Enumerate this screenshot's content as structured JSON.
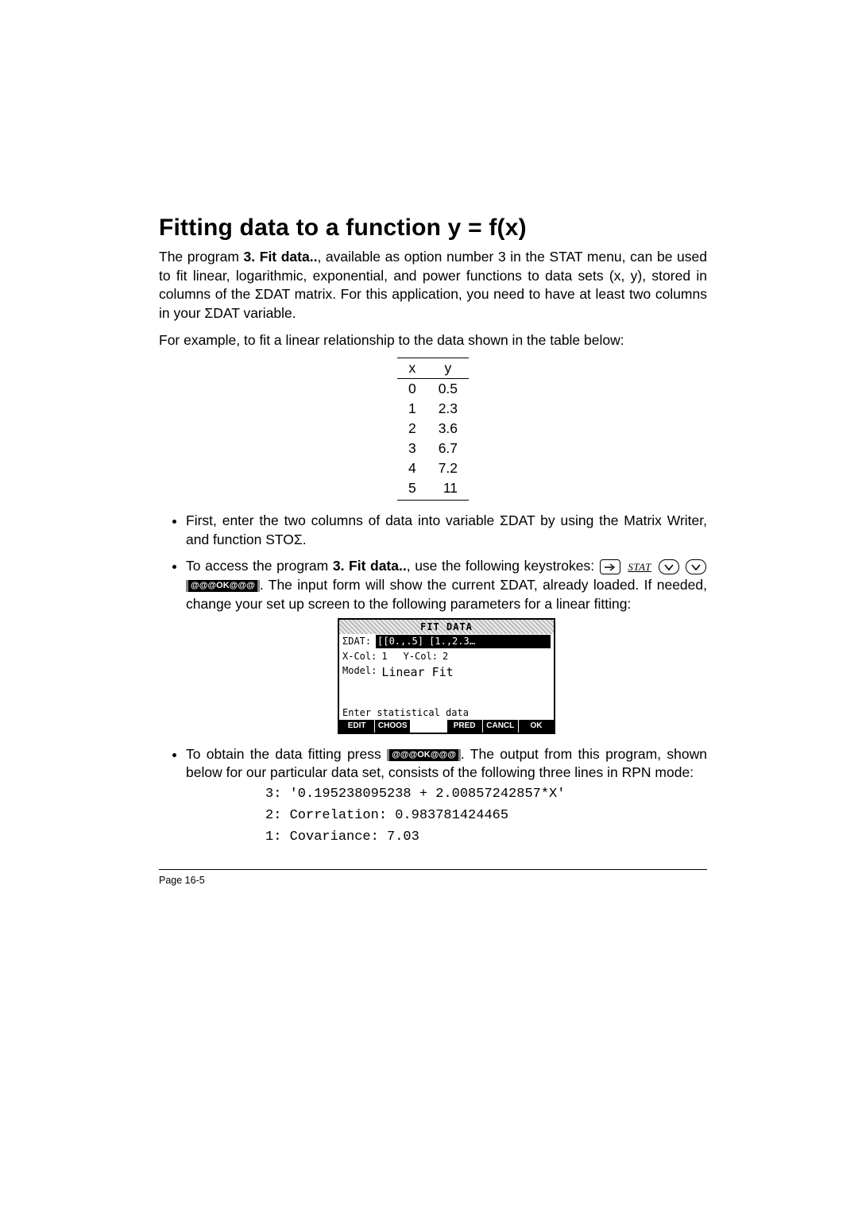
{
  "title": "Fitting data to a function y = f(x)",
  "para1_a": "The program ",
  "program_name": "3. Fit data..",
  "para1_b": ", available as option number 3 in the STAT menu, can be used to fit linear, logarithmic, exponential, and power functions to data sets (x, y), stored in columns of the ΣDAT matrix.  For this application, you need to have at least two columns in your ΣDAT variable.",
  "para2": "For example, to fit a linear relationship to the data shown in the table below:",
  "table": {
    "headers": [
      "x",
      "y"
    ],
    "rows": [
      [
        "0",
        "0.5"
      ],
      [
        "1",
        "2.3"
      ],
      [
        "2",
        "3.6"
      ],
      [
        "3",
        "6.7"
      ],
      [
        "4",
        "7.2"
      ],
      [
        "5",
        "11"
      ]
    ]
  },
  "bullet1": "First, enter the two columns of data into variable ΣDAT by using the Matrix Writer, and function STOΣ.",
  "bullet2_a": "To access the program ",
  "bullet2_b": ", use the following keystrokes: ",
  "stat_key_label": "STAT",
  "ok_soft": "@@@OK@@@",
  "bullet2_c": ".  The input form will show the current ΣDAT, already loaded.  If needed, change your set up screen to the following parameters for a linear fitting:",
  "calc": {
    "titlebar": "FIT DATA",
    "sdat_label": "ΣDAT:",
    "sdat_value": "[[0.,.5] [1.,2.3…",
    "xcol_label": "X-Col:",
    "xcol_val": "1",
    "ycol_label": "Y-Col:",
    "ycol_val": "2",
    "model_label": "Model:",
    "model_val": "Linear Fit",
    "prompt": "Enter statistical data",
    "soft": [
      "EDIT",
      "CHOOS",
      "",
      "PRED",
      "CANCL",
      "OK"
    ]
  },
  "bullet3_a": "To obtain the data fitting press ",
  "bullet3_b": ".  The output from this program, shown below for our particular data set, consists of the following three lines in RPN mode:",
  "rpn": {
    "l3": "3: '0.195238095238 + 2.00857242857*X'",
    "l2": "2: Correlation: 0.983781424465",
    "l1": "1: Covariance: 7.03"
  },
  "pagenum": "Page 16-5",
  "chart_data": {
    "type": "table",
    "columns": [
      "x",
      "y"
    ],
    "rows": [
      [
        0,
        0.5
      ],
      [
        1,
        2.3
      ],
      [
        2,
        3.6
      ],
      [
        3,
        6.7
      ],
      [
        4,
        7.2
      ],
      [
        5,
        11
      ]
    ]
  }
}
